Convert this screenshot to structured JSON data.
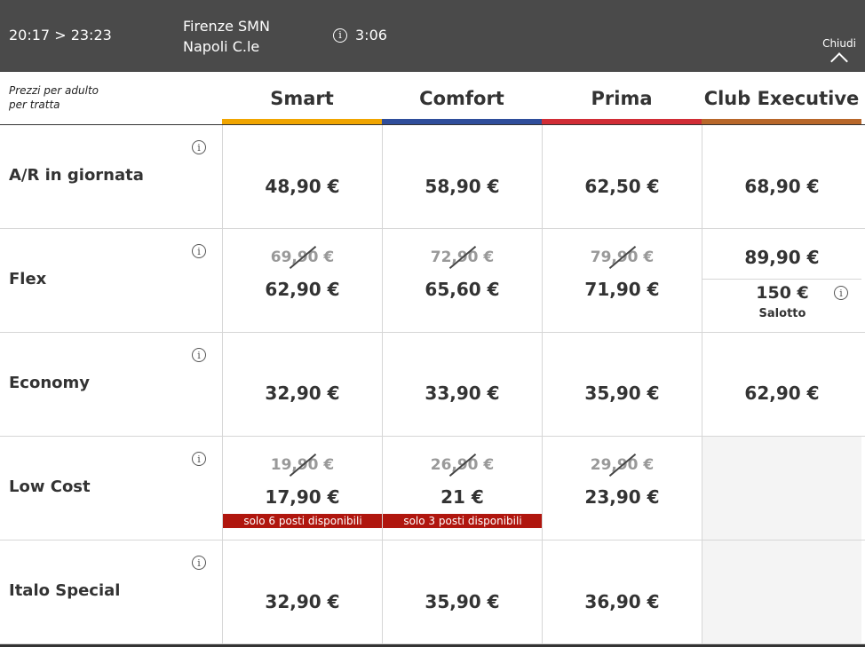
{
  "header": {
    "times": "20:17 > 23:23",
    "from": "Firenze SMN",
    "to": "Napoli C.le",
    "duration": "3:06",
    "close_label": "Chiudi",
    "info_glyph": "i"
  },
  "intro": {
    "line1": "Prezzi per adulto",
    "line2": "per tratta"
  },
  "columns": [
    {
      "title": "Smart",
      "color": "#f0a500"
    },
    {
      "title": "Comfort",
      "color": "#2f4e9b"
    },
    {
      "title": "Prima",
      "color": "#d12d36"
    },
    {
      "title": "Club Executive",
      "color": "#b8672a"
    }
  ],
  "rows": [
    {
      "label": "A/R in giornata",
      "cells": [
        {
          "price": "48,90 €"
        },
        {
          "price": "58,90 €"
        },
        {
          "price": "62,50 €"
        },
        {
          "price": "68,90 €"
        }
      ]
    },
    {
      "label": "Flex",
      "cells": [
        {
          "old": "69,90 €",
          "price": "62,90 €"
        },
        {
          "old": "72,90 €",
          "price": "65,60 €"
        },
        {
          "old": "79,90 €",
          "price": "71,90 €"
        },
        {
          "price": "89,90 €",
          "salotto_price": "150 €",
          "salotto_label": "Salotto"
        }
      ]
    },
    {
      "label": "Economy",
      "cells": [
        {
          "price": "32,90 €"
        },
        {
          "price": "33,90 €"
        },
        {
          "price": "35,90 €"
        },
        {
          "price": "62,90 €"
        }
      ]
    },
    {
      "label": "Low Cost",
      "cells": [
        {
          "old": "19,90 €",
          "price": "17,90 €",
          "badge": "solo 6 posti disponibili"
        },
        {
          "old": "26,90 €",
          "price": "21 €",
          "badge": "solo 3 posti disponibili"
        },
        {
          "old": "29,90 €",
          "price": "23,90 €"
        },
        {}
      ]
    },
    {
      "label": "Italo Special",
      "cells": [
        {
          "price": "32,90 €"
        },
        {
          "price": "35,90 €"
        },
        {
          "price": "36,90 €"
        },
        {}
      ]
    }
  ]
}
